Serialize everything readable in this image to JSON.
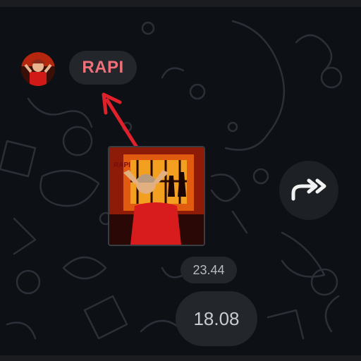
{
  "sender": {
    "name": "RAPI",
    "avatar_icon": "rapper-avatar-icon",
    "name_color": "#f0707a"
  },
  "message": {
    "media_icon": "photo-thumbnail-icon",
    "time_primary": "23.44",
    "time_secondary": "18.08"
  },
  "forward": {
    "icon": "forward-icon"
  },
  "annotation": {
    "arrow_color": "#e0202a",
    "arrow_icon": "red-arrow-icon"
  }
}
